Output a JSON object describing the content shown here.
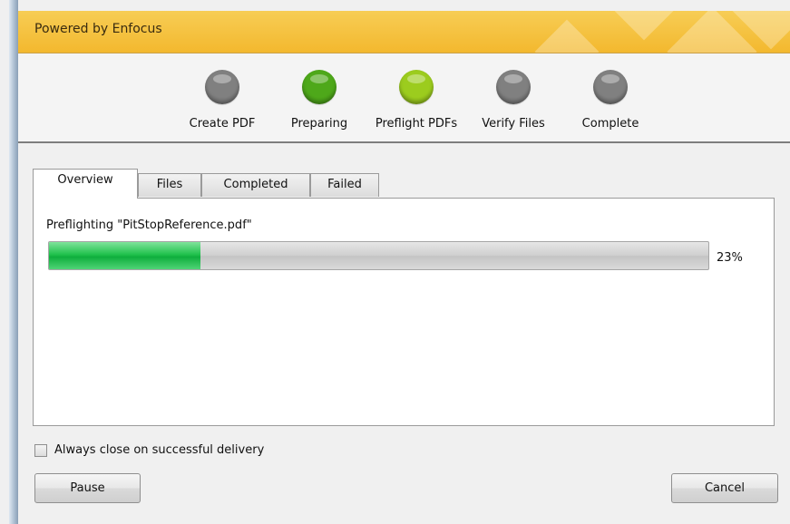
{
  "banner": {
    "title": "Powered by Enfocus"
  },
  "colors": {
    "banner": "#f3b82e",
    "step_inactive": "#808080",
    "step_done": "#4ea81a",
    "step_active": "#9ccc1e",
    "progress": "#22c24e"
  },
  "steps": [
    {
      "label": "Create PDF",
      "state": "inactive",
      "icon": "gray-circle-icon"
    },
    {
      "label": "Preparing",
      "state": "done",
      "icon": "green-circle-icon"
    },
    {
      "label": "Preflight PDFs",
      "state": "active",
      "icon": "yellow-green-circle-icon"
    },
    {
      "label": "Verify Files",
      "state": "inactive",
      "icon": "gray-circle-icon"
    },
    {
      "label": "Complete",
      "state": "inactive",
      "icon": "gray-circle-icon"
    }
  ],
  "tabs": [
    {
      "label": "Overview",
      "active": true
    },
    {
      "label": "Files",
      "active": false
    },
    {
      "label": "Completed",
      "active": false
    },
    {
      "label": "Failed",
      "active": false
    }
  ],
  "overview": {
    "status": "Preflighting \"PitStopReference.pdf\"",
    "progress_percent_label": "23%",
    "progress_fraction": 0.23
  },
  "options": {
    "always_close_label": "Always close on successful delivery",
    "always_close_checked": false
  },
  "buttons": {
    "pause": "Pause",
    "cancel": "Cancel"
  }
}
